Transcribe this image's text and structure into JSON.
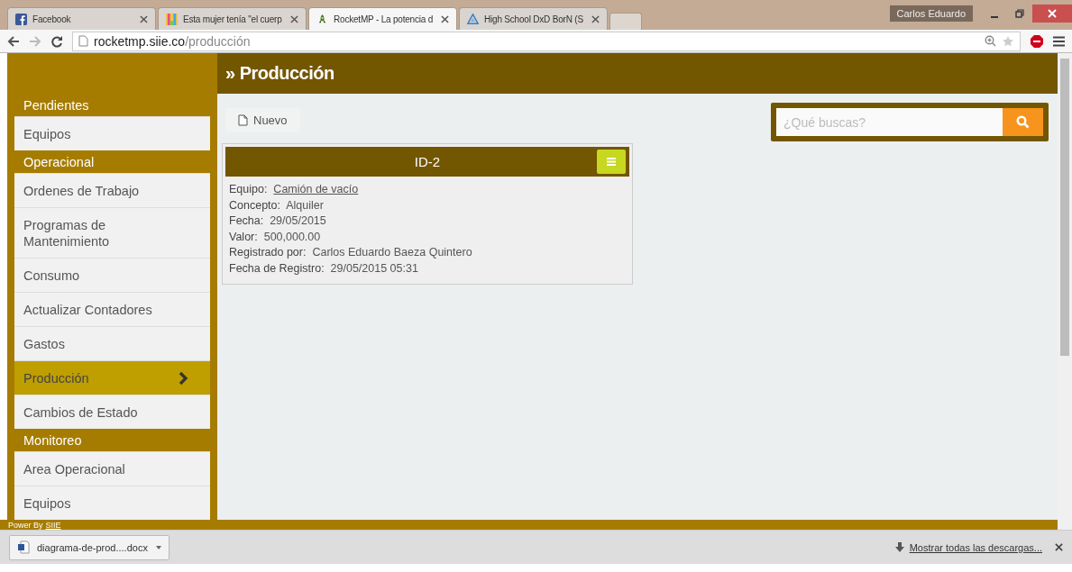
{
  "browser": {
    "tabs": [
      {
        "title": "Facebook",
        "selected": false
      },
      {
        "title": "Esta mujer tenía \"el cuerp",
        "selected": false
      },
      {
        "title": "RocketMP - La potencia d",
        "selected": true
      },
      {
        "title": "High School DxD BorN (S",
        "selected": false
      }
    ],
    "user": "Carlos Eduardo",
    "url_host": "rocketmp.siie.co",
    "url_path": "/producción"
  },
  "sidebar": {
    "sections": [
      {
        "header": "Pendientes",
        "items": [
          {
            "label": "Equipos",
            "selected": false
          }
        ]
      },
      {
        "header": "Operacional",
        "items": [
          {
            "label": "Ordenes de Trabajo",
            "selected": false
          },
          {
            "label": "Programas de Mantenimiento",
            "selected": false
          },
          {
            "label": "Consumo",
            "selected": false
          },
          {
            "label": "Actualizar Contadores",
            "selected": false
          },
          {
            "label": "Gastos",
            "selected": false
          },
          {
            "label": "Producción",
            "selected": true
          },
          {
            "label": "Cambios de Estado",
            "selected": false
          }
        ]
      },
      {
        "header": "Monitoreo",
        "items": [
          {
            "label": "Area Operacional",
            "selected": false
          },
          {
            "label": "Equipos",
            "selected": false
          }
        ]
      }
    ]
  },
  "page": {
    "title": "» Producción",
    "new_button": "Nuevo",
    "search": {
      "placeholder": "¿Qué buscas?"
    },
    "card": {
      "title": "ID-2",
      "fields": [
        {
          "label": "Equipo:",
          "value": "Camión de vacío",
          "kind": "link"
        },
        {
          "label": "Concepto:",
          "value": "Alquiler",
          "kind": "text"
        },
        {
          "label": "Fecha:",
          "value": "29/05/2015",
          "kind": "text"
        },
        {
          "label": "Valor:",
          "value": "500,000.00",
          "kind": "text"
        },
        {
          "label": "Registrado por:",
          "value": "Carlos Eduardo Baeza Quintero",
          "kind": "text"
        },
        {
          "label": "Fecha de Registro:",
          "value": "29/05/2015 05:31",
          "kind": "text"
        }
      ]
    }
  },
  "footer": {
    "prefix": "Power By",
    "link": "SIIE"
  },
  "downloads": {
    "file": "diagrama-de-prod....docx",
    "show_all": "Mostrar todas las descargas..."
  }
}
